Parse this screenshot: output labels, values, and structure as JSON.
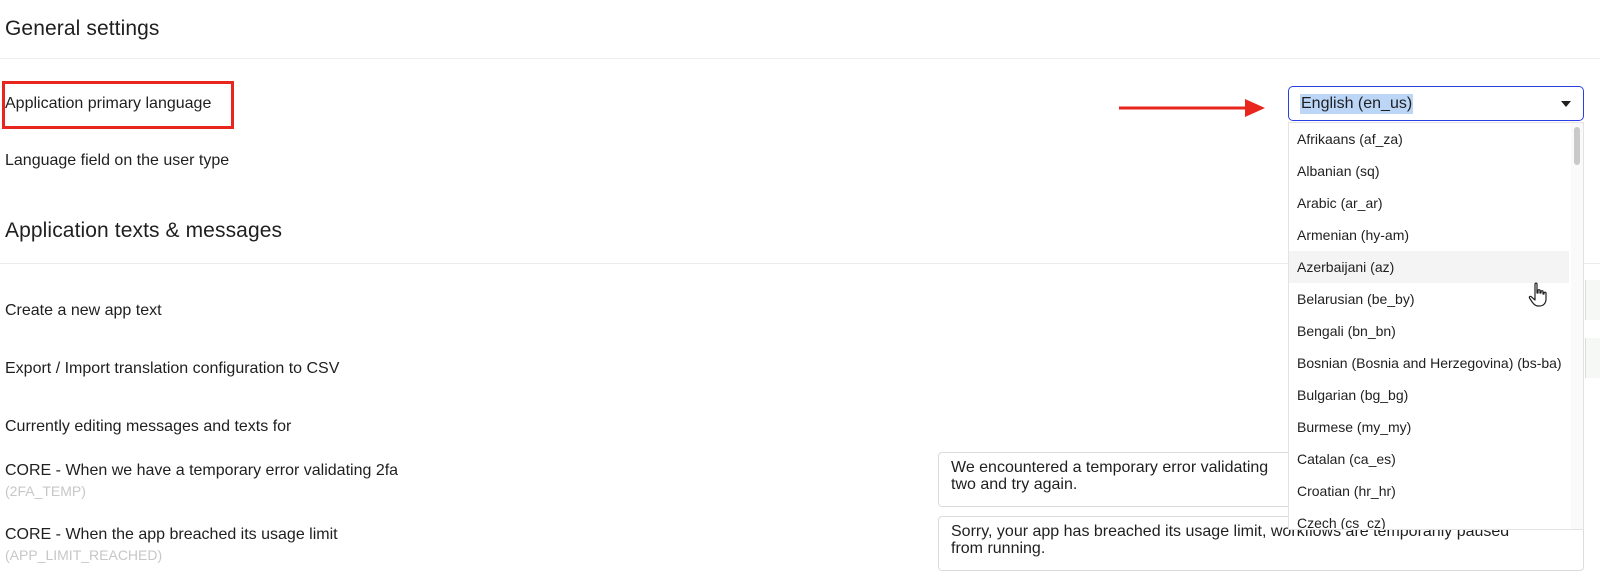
{
  "general": {
    "title": "General settings",
    "primary_language_label": "Application primary language",
    "language_field_label": "Language field on the user type"
  },
  "language_select": {
    "value": "English (en_us)",
    "options": [
      "Afrikaans (af_za)",
      "Albanian (sq)",
      "Arabic (ar_ar)",
      "Armenian (hy-am)",
      "Azerbaijani (az)",
      "Belarusian (be_by)",
      "Bengali (bn_bn)",
      "Bosnian (Bosnia and Herzegovina) (bs-ba)",
      "Bulgarian (bg_bg)",
      "Burmese (my_my)",
      "Catalan (ca_es)",
      "Croatian (hr_hr)",
      "Czech (cs_cz)"
    ],
    "hovered_option": "Azerbaijani (az)"
  },
  "texts": {
    "title": "Application texts & messages",
    "create_label": "Create a new app text",
    "export_label": "Export / Import translation configuration to CSV",
    "editing_label": "Currently editing messages and texts for",
    "messages": [
      {
        "label": "CORE - When we have a temporary error validating 2fa",
        "key": "(2FA_TEMP)",
        "line1": "We encountered a temporary error validating",
        "line2": "two and try again."
      },
      {
        "label": "CORE - When the app breached its usage limit",
        "key": "(APP_LIMIT_REACHED)",
        "line1": "Sorry, your app has breached its usage limit, workflows are temporarily paused",
        "line2": "from running."
      }
    ]
  },
  "colors": {
    "highlight": "#e8261d",
    "select_border": "#2a3ee6",
    "selection_bg": "#bcd6f8",
    "key_text": "#c7c7c7"
  }
}
